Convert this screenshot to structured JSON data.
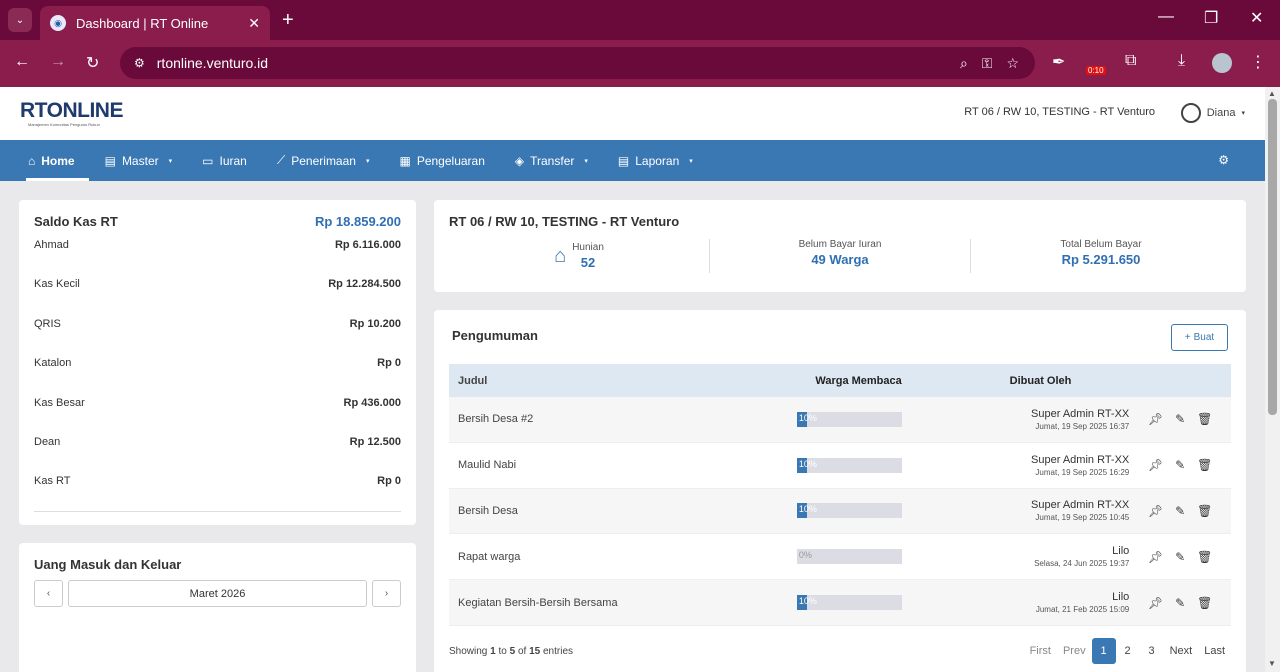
{
  "browser": {
    "tab_title": "Dashboard | RT Online",
    "url": "rtonline.venturo.id",
    "recording_time": "0:10"
  },
  "header": {
    "logo_rt": "RT",
    "logo_online": "ONLINE",
    "logo_sub": "Manajemen Komunitas Pengurus Rukun",
    "rt_name": "RT 06 / RW 10, TESTING - RT Venturo",
    "user_name": "Diana"
  },
  "nav": {
    "home": "Home",
    "master": "Master",
    "iuran": "Iuran",
    "penerimaan": "Penerimaan",
    "pengeluaran": "Pengeluaran",
    "transfer": "Transfer",
    "laporan": "Laporan"
  },
  "saldo": {
    "title": "Saldo Kas RT",
    "total": "Rp 18.859.200",
    "rows": [
      {
        "name": "Ahmad",
        "amount": "Rp 6.116.000"
      },
      {
        "name": "Kas Kecil",
        "amount": "Rp 12.284.500"
      },
      {
        "name": "QRIS",
        "amount": "Rp 10.200"
      },
      {
        "name": "Katalon",
        "amount": "Rp 0"
      },
      {
        "name": "Kas Besar",
        "amount": "Rp 436.000"
      },
      {
        "name": "Dean",
        "amount": "Rp 12.500"
      },
      {
        "name": "Kas RT",
        "amount": "Rp 0"
      }
    ]
  },
  "uang": {
    "title": "Uang Masuk dan Keluar",
    "month": "Maret 2026",
    "prev": "‹",
    "next": "›"
  },
  "summary": {
    "title": "RT 06 / RW 10, TESTING - RT Venturo",
    "hunian_label": "Hunian",
    "hunian_value": "52",
    "belum_label": "Belum Bayar Iuran",
    "belum_value": "49 Warga",
    "total_label": "Total Belum Bayar",
    "total_value": "Rp 5.291.650"
  },
  "pengumuman": {
    "title": "Pengumuman",
    "buat_label": "Buat",
    "columns": {
      "judul": "Judul",
      "warga": "Warga Membaca",
      "oleh": "Dibuat Oleh"
    },
    "rows": [
      {
        "judul": "Bersih Desa #2",
        "pct": "10%",
        "fill": 0.1,
        "oleh": "Super Admin RT-XX",
        "date": "Jumat, 19 Sep 2025 16:37"
      },
      {
        "judul": "Maulid Nabi",
        "pct": "10%",
        "fill": 0.1,
        "oleh": "Super Admin RT-XX",
        "date": "Jumat, 19 Sep 2025 16:29"
      },
      {
        "judul": "Bersih Desa",
        "pct": "10%",
        "fill": 0.1,
        "oleh": "Super Admin RT-XX",
        "date": "Jumat, 19 Sep 2025 10:45"
      },
      {
        "judul": "Rapat warga",
        "pct": "0%",
        "fill": 0,
        "oleh": "Lilo",
        "date": "Selasa, 24 Jun 2025 19:37"
      },
      {
        "judul": "Kegiatan Bersih-Bersih Bersama",
        "pct": "10%",
        "fill": 0.1,
        "oleh": "Lilo",
        "date": "Jumat, 21 Feb 2025 15:09"
      }
    ],
    "footer": {
      "showing": "Showing",
      "from": "1",
      "to_word": "to",
      "to": "5",
      "of_word": "of",
      "total": "15",
      "entries": "entries"
    },
    "pager": {
      "first": "First",
      "prev": "Prev",
      "p1": "1",
      "p2": "2",
      "p3": "3",
      "next": "Next",
      "last": "Last"
    }
  },
  "colors": {
    "accent": "#3a78b4",
    "chrome": "#8b1d4d"
  }
}
